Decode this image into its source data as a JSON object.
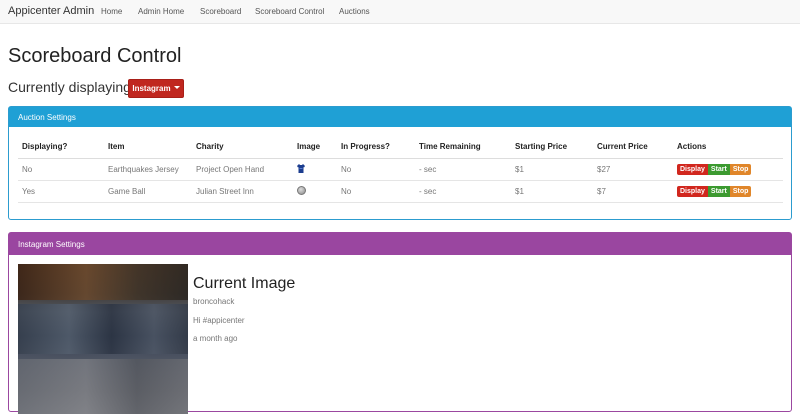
{
  "navbar": {
    "brand": "Appicenter Admin",
    "links": [
      "Home",
      "Admin Home",
      "Scoreboard",
      "Scoreboard Control",
      "Auctions"
    ]
  },
  "page": {
    "title": "Scoreboard Control",
    "displaying_label": "Currently displaying:",
    "displaying_value": "Instagram"
  },
  "auction": {
    "heading": "Auction Settings",
    "columns": [
      "Displaying?",
      "Item",
      "Charity",
      "Image",
      "In Progress?",
      "Time Remaining",
      "Starting Price",
      "Current Price",
      "Actions"
    ],
    "rows": [
      {
        "displaying": "No",
        "item": "Earthquakes Jersey",
        "charity": "Project Open Hand",
        "image_icon": "jersey-icon",
        "in_progress": "No",
        "time_remaining": "- sec",
        "starting_price": "$1",
        "current_price": "$27"
      },
      {
        "displaying": "Yes",
        "item": "Game Ball",
        "charity": "Julian Street Inn",
        "image_icon": "ball-icon",
        "in_progress": "No",
        "time_remaining": "- sec",
        "starting_price": "$1",
        "current_price": "$7"
      }
    ],
    "actions": {
      "display": "Display",
      "start": "Start",
      "stop": "Stop"
    }
  },
  "instagram": {
    "heading": "Instagram Settings",
    "current_title": "Current Image",
    "username": "broncohack",
    "caption": "Hi #appicenter",
    "posted": "a month ago"
  },
  "colors": {
    "auction_panel": "#1fa0d5",
    "instagram_panel": "#9a46a0",
    "dropdown": "#c0271f",
    "btn_display": "#d1271e",
    "btn_start": "#3c9a30",
    "btn_stop": "#e0862a"
  }
}
